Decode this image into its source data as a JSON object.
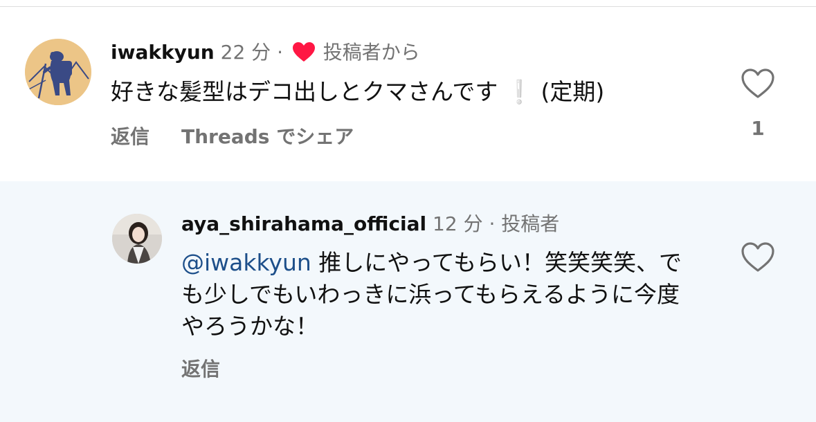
{
  "comments": [
    {
      "username": "iwakkyun",
      "time": "22 分",
      "separator": "·",
      "author_tag": "投稿者から",
      "body": "好きな髪型はデコ出しとクマさんです",
      "body_suffix": "(定期)",
      "reply_label": "返信",
      "share_label": "Threads でシェア",
      "like_count": "1",
      "icons": [
        "bear-hiker-avatar",
        "red-heart-icon",
        "exclamation-icon",
        "heart-outline-icon"
      ]
    },
    {
      "username": "aya_shirahama_official",
      "time": "12 分",
      "separator": "·",
      "author_tag": "投稿者",
      "mention": "@iwakkyun",
      "body": "推しにやってもらい！笑笑笑笑、でも少しでもいわっきに浜ってもらえるように今度やろうかな！",
      "reply_label": "返信",
      "icons": [
        "profile-photo-avatar",
        "heart-outline-icon"
      ]
    }
  ],
  "colors": {
    "liked_heart": "#ff1744",
    "reply_background": "#f3f8fc",
    "mention": "#1d4f8a",
    "secondary_text": "#737373",
    "avatar1_background": "#ecc587",
    "avatar1_figure": "#3a4a85"
  }
}
